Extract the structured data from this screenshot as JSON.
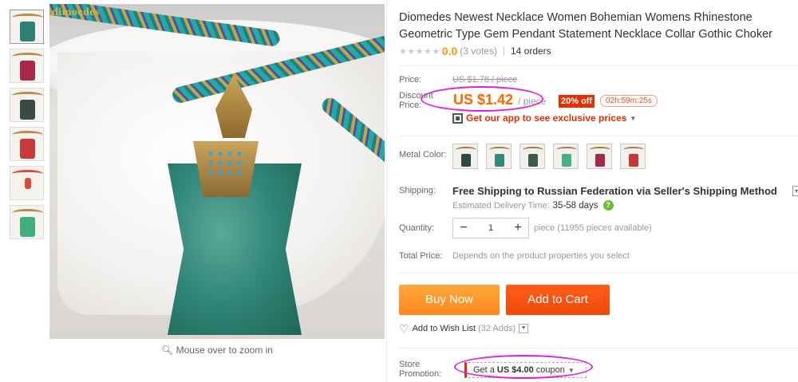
{
  "gallery": {
    "brand": "dimoedes",
    "zoom_hint": "Mouse over to zoom in",
    "thumb_colors": [
      "#2f7f72",
      "#a8284a",
      "#3a4a44",
      "#c83a3a",
      "#d84a3a",
      "#3fae7a"
    ]
  },
  "product": {
    "title": "Diomedes Newest Necklace Women Bohemian Womens Rhinestone Geometric Type Gem Pendant Statement Necklace Collar Gothic Choker",
    "stars": "★★★★★",
    "rating": "0.0",
    "votes": "(3 votes)",
    "orders": "14 orders"
  },
  "pricing": {
    "price_label": "Price:",
    "original_price": "US $1.78 / piece",
    "discount_label_1": "Discount",
    "discount_label_2": "Price:",
    "discount_price": "US $1.42",
    "unit": "/ piece",
    "discount_badge": "20% off",
    "countdown": "02h:59m:25s",
    "app_promo": "Get our app to see exclusive prices",
    "dropdown_caret": "▼"
  },
  "options": {
    "metal_color_label": "Metal Color:",
    "colors": [
      "#2f4840",
      "#2f8a7a",
      "#3c5a4e",
      "#4caf80",
      "#a0284a",
      "#c83838"
    ]
  },
  "shipping": {
    "label": "Shipping:",
    "method": "Free Shipping to Russian Federation via Seller's Shipping Method",
    "toggle": "▾",
    "estimate_label": "Estimated Delivery Time:",
    "estimate_days": "35-58 days",
    "help_icon": "?"
  },
  "quantity": {
    "label": "Quantity:",
    "minus": "−",
    "value": "1",
    "plus": "+",
    "available": "piece (11955 pieces available)"
  },
  "total": {
    "label": "Total Price:",
    "note": "Depends on the product properties you select"
  },
  "actions": {
    "buy_now": "Buy Now",
    "add_to_cart": "Add to Cart",
    "wishlist": "Add to Wish List",
    "wishlist_count": "(32 Adds)",
    "wishlist_dd": "▼"
  },
  "promotion": {
    "label_1": "Store",
    "label_2": "Promotion:",
    "coupon_prefix": "Get a",
    "coupon_amount": "US $4.00",
    "coupon_suffix": "coupon",
    "coupon_caret": "▼"
  },
  "annotation_color": "#e020e0"
}
